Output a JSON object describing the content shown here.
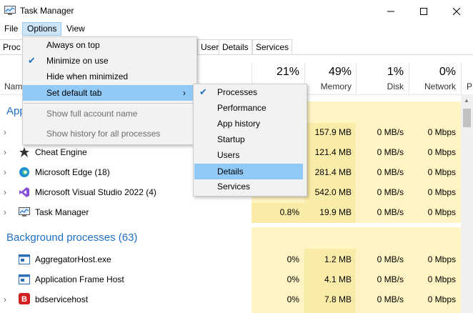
{
  "window": {
    "title": "Task Manager"
  },
  "menubar": {
    "items": [
      "File",
      "Options",
      "View"
    ]
  },
  "tabs": [
    "Proc",
    "Users",
    "Details",
    "Services"
  ],
  "header": {
    "name_partial": "Nam",
    "p_partial": "P",
    "columns": [
      {
        "pct": "21%",
        "label": "Memory",
        "pct_label": "49%"
      }
    ],
    "cpu_pct": "21%",
    "memory_pct": "49%",
    "disk_pct": "1%",
    "network_pct": "0%",
    "memory_label": "Memory",
    "disk_label": "Disk",
    "network_label": "Network"
  },
  "groups": {
    "apps_partial": "App",
    "background": "Background processes (63)"
  },
  "rows": [
    {
      "name": "",
      "cpu": "",
      "memory": "157.9 MB",
      "disk": "0 MB/s",
      "network": "0 Mbps"
    },
    {
      "name": "Cheat Engine",
      "cpu": "",
      "memory": "121.4 MB",
      "disk": "0 MB/s",
      "network": "0 Mbps"
    },
    {
      "name": "Microsoft Edge (18)",
      "cpu": "",
      "memory": "281.4 MB",
      "disk": "0 MB/s",
      "network": "0 Mbps"
    },
    {
      "name": "Microsoft Visual Studio 2022 (4)",
      "cpu": "",
      "memory": "542.0 MB",
      "disk": "0 MB/s",
      "network": "0 Mbps"
    },
    {
      "name": "Task Manager",
      "cpu": "0.8%",
      "memory": "19.9 MB",
      "disk": "0 MB/s",
      "network": "0 Mbps"
    }
  ],
  "bg_rows": [
    {
      "name": "AggregatorHost.exe",
      "cpu": "0%",
      "memory": "1.2 MB",
      "disk": "0 MB/s",
      "network": "0 Mbps"
    },
    {
      "name": "Application Frame Host",
      "cpu": "0%",
      "memory": "4.1 MB",
      "disk": "0 MB/s",
      "network": "0 Mbps"
    },
    {
      "name": "bdservicehost",
      "cpu": "0%",
      "memory": "7.8 MB",
      "disk": "0 MB/s",
      "network": "0 Mbps"
    }
  ],
  "options_menu": {
    "always_on_top": "Always on top",
    "minimize_on_use": "Minimize on use",
    "hide_when_minimized": "Hide when minimized",
    "set_default_tab": "Set default tab",
    "show_full_account_name": "Show full account name",
    "show_history": "Show history for all processes"
  },
  "default_tab_menu": {
    "processes": "Processes",
    "performance": "Performance",
    "app_history": "App history",
    "startup": "Startup",
    "users": "Users",
    "details": "Details",
    "services": "Services"
  },
  "colors": {
    "heat_light": "#fff4c4",
    "heat_medium": "#f9eca8",
    "highlight": "#91c9f7",
    "accent": "#1f6fc2"
  }
}
